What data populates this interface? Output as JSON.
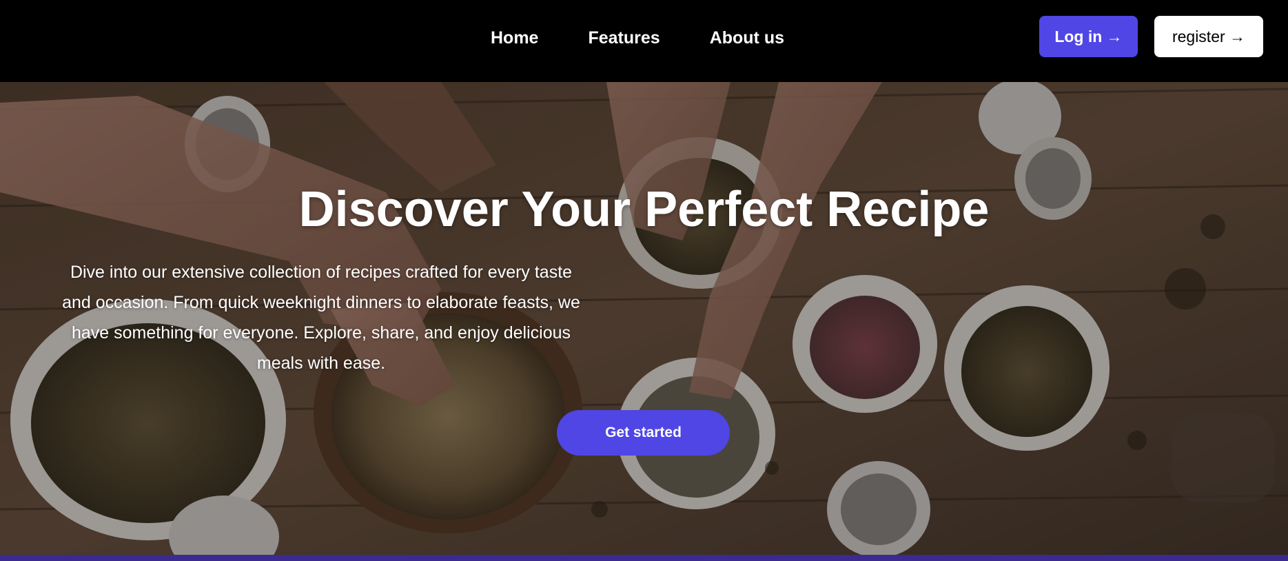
{
  "nav": {
    "links": [
      "Home",
      "Features",
      "About us"
    ],
    "login_label": "Log in →",
    "register_label": "register →"
  },
  "hero": {
    "title": "Discover Your Perfect Recipe",
    "description": "Dive into our extensive collection of recipes crafted for every taste and occasion. From quick weeknight dinners to elaborate feasts, we have something for everyone. Explore, share, and enjoy delicious meals with ease.",
    "cta_label": "Get started",
    "image": "overhead photo of hands picking herbs and grains from bowls on a wooden table"
  },
  "colors": {
    "accent": "#4f46e5",
    "navbar_bg": "#000000",
    "bottom_strip": "#3b2a8f"
  }
}
